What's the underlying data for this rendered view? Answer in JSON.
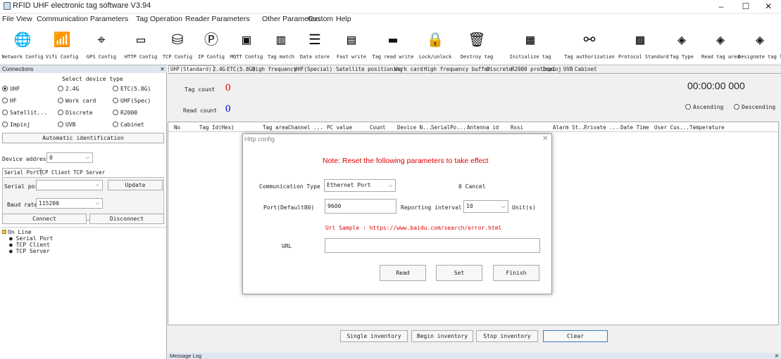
{
  "window": {
    "title": "RFID UHF electronic tag software V3.94",
    "minimize": "–",
    "maximize": "☐",
    "close": "✕"
  },
  "menu": [
    "File",
    "View",
    "Communication Parameters",
    "Tag Operation",
    "Reader Parameters",
    "Other Parameters",
    "Custom",
    "Help"
  ],
  "toolbar": [
    {
      "label": "Network Config",
      "icon": "globe-icon",
      "glyph": "🌐"
    },
    {
      "label": "Vifi Config",
      "icon": "wifi-icon",
      "glyph": "📶"
    },
    {
      "label": "GPS Config",
      "icon": "gps-icon",
      "glyph": "⌖"
    },
    {
      "label": "HTTP Config",
      "icon": "http-icon",
      "glyph": "▭"
    },
    {
      "label": "TCP Config",
      "icon": "tcp-icon",
      "glyph": "⛁"
    },
    {
      "label": "IP Config",
      "icon": "ip-icon",
      "glyph": "Ⓟ"
    },
    {
      "label": "MQTT Config",
      "icon": "mqtt-icon",
      "glyph": "▣"
    },
    {
      "label": "Tag match",
      "icon": "tag-match-icon",
      "glyph": "▥"
    },
    {
      "label": "Data store",
      "icon": "data-store-icon",
      "glyph": "☰"
    },
    {
      "label": "Fast write",
      "icon": "fast-write-icon",
      "glyph": "▤"
    },
    {
      "label": "Tag read write",
      "icon": "tag-rw-icon",
      "glyph": "▬"
    },
    {
      "label": "Lock/unlock",
      "icon": "lock-icon",
      "glyph": "🔒"
    },
    {
      "label": "Destroy tag",
      "icon": "trash-icon",
      "glyph": "🗑"
    },
    {
      "label": "Initialize tag",
      "icon": "init-icon",
      "glyph": "▦"
    },
    {
      "label": "Tag authorization",
      "icon": "auth-icon",
      "glyph": "⚯"
    },
    {
      "label": "Protocol Standard",
      "icon": "protocol-icon",
      "glyph": "▩"
    },
    {
      "label": "Tag Type",
      "icon": "tag-type-icon",
      "glyph": "◈"
    },
    {
      "label": "Read tag area",
      "icon": "read-area-icon",
      "glyph": "◈"
    },
    {
      "label": "Designate tag l",
      "icon": "designate-icon",
      "glyph": "◈"
    }
  ],
  "connections": {
    "header": "Connections",
    "close": "✕",
    "select_label": "Select device type",
    "types": [
      "UHF",
      "2.4G",
      "ETC(5.8G)",
      "HF",
      "Work card",
      "UHF(Spec)",
      "Satellit...",
      "Discrete",
      "R2000",
      "Impinj",
      "UVB",
      "Cabinet"
    ],
    "auto_id": "Automatic identification",
    "device_address_label": "Device address",
    "device_address": "0",
    "tabs": [
      "Serial Port",
      "TCP Client",
      "TCP Server"
    ],
    "serial_port_label": "Serial port",
    "serial_port": "",
    "update": "Update",
    "baud_label": "Baud rate",
    "baud": "115200",
    "connect": "Connect",
    "disconnect": "Disconnect",
    "tree": [
      "On Line",
      "Serial Port",
      "TCP Client",
      "TCP Server"
    ]
  },
  "main": {
    "tabs": [
      "UHF(Standard)",
      "2.4G",
      "ETC(5.8G)",
      "High frequency",
      "UHF(Special)",
      "Satellite positioning",
      "Work card",
      "High frequency buffer",
      "Discrete",
      "R2000 protocol",
      "Impinj",
      "UVB",
      "Cabinet"
    ],
    "tag_count_label": "Tag count",
    "tag_count": "0",
    "read_count_label": "Read count",
    "read_count": "0",
    "timer": "00:00:00 000",
    "ascending": "Ascending",
    "descending": "Descending",
    "columns": [
      "No",
      "Tag Id(Hex)",
      "Tag area",
      "Channel ...",
      "PC value",
      "Count",
      "Device N...",
      "SerialPo...",
      "Antenna id",
      "Rssi",
      "Alarm St...",
      "Private ...",
      "Date Time",
      "User Cus...",
      "Temperature"
    ],
    "single": "Single inventory",
    "begin": "Begin inventory",
    "stop": "Stop inventory",
    "clear": "Clear"
  },
  "dialog": {
    "title": "Http config",
    "close": "✕",
    "note": "Note: Reset the following parameters to take effect",
    "comm_type_label": "Communication Type",
    "comm_type": "Ethernet Port",
    "cancel": "0 Cancel",
    "port_label": "Port(Default80)",
    "port": "9600",
    "interval_label": "Reporting interval",
    "interval": "10",
    "unit": "Unit(s)",
    "url_sample": "Url Sample : https://www.baidu.com/search/error.html",
    "url_label": "URL",
    "url": "",
    "read": "Read",
    "set": "Set",
    "finish": "Finish"
  },
  "msglog": {
    "label": "Message Log",
    "close": "✕"
  },
  "colors": {
    "red": "#e00000",
    "blue": "#0000cc",
    "panel": "#dfe6ef"
  }
}
